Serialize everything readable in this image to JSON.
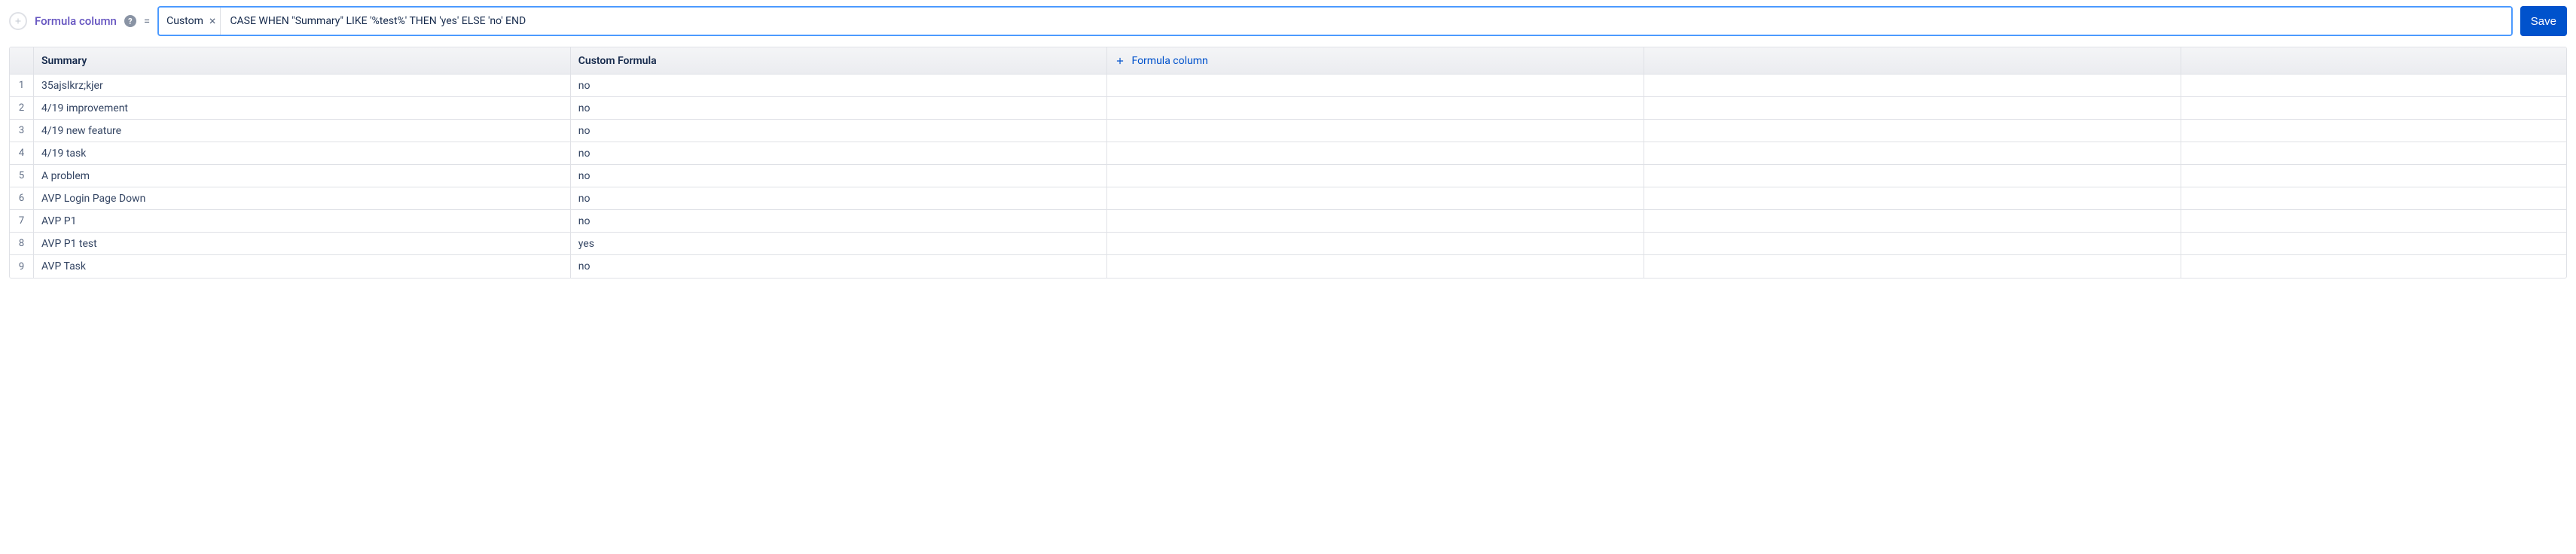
{
  "formulaBar": {
    "label": "Formula column",
    "help": "?",
    "equals": "=",
    "chipLabel": "Custom",
    "chipClose": "×",
    "inputValue": "CASE WHEN \"Summary\" LIKE '%test%' THEN 'yes' ELSE 'no' END",
    "saveLabel": "Save"
  },
  "columns": {
    "summary": "Summary",
    "custom": "Custom Formula",
    "formulaAdd": "Formula column"
  },
  "rows": [
    {
      "n": "1",
      "summary": "35ajslkrz;kjer",
      "custom": "no"
    },
    {
      "n": "2",
      "summary": "4/19 improvement",
      "custom": "no"
    },
    {
      "n": "3",
      "summary": "4/19 new feature",
      "custom": "no"
    },
    {
      "n": "4",
      "summary": "4/19 task",
      "custom": "no"
    },
    {
      "n": "5",
      "summary": "A problem",
      "custom": "no"
    },
    {
      "n": "6",
      "summary": "AVP Login Page Down",
      "custom": "no"
    },
    {
      "n": "7",
      "summary": "AVP P1",
      "custom": "no"
    },
    {
      "n": "8",
      "summary": "AVP P1 test",
      "custom": "yes"
    },
    {
      "n": "9",
      "summary": "AVP Task",
      "custom": "no"
    }
  ]
}
